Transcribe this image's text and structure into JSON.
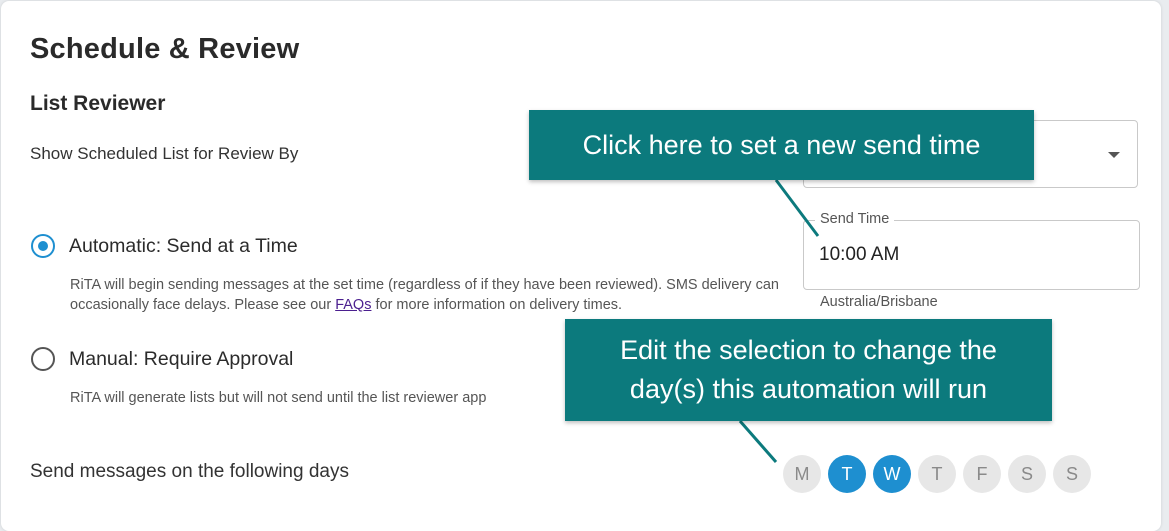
{
  "page": {
    "title": "Schedule & Review",
    "section_title": "List Reviewer"
  },
  "review": {
    "show_by_label": "Show Scheduled List for Review By",
    "select_value": ""
  },
  "send_time": {
    "label": "Send Time",
    "value": "10:00 AM",
    "timezone": "Australia/Brisbane"
  },
  "options": [
    {
      "label": "Automatic: Send at a Time",
      "checked": true,
      "helper_before": "RiTA will begin sending messages at the set time (regardless of if they have been reviewed). SMS delivery can occasionally face delays. Please see our ",
      "helper_link": "FAQs",
      "helper_after": " for more information on delivery times."
    },
    {
      "label": "Manual: Require Approval",
      "checked": false,
      "helper": "RiTA will generate lists but will not send until the list reviewer app"
    }
  ],
  "days": {
    "label": "Send messages on the following days",
    "items": [
      {
        "letter": "M",
        "selected": false
      },
      {
        "letter": "T",
        "selected": true
      },
      {
        "letter": "W",
        "selected": true
      },
      {
        "letter": "T",
        "selected": false
      },
      {
        "letter": "F",
        "selected": false
      },
      {
        "letter": "S",
        "selected": false
      },
      {
        "letter": "S",
        "selected": false
      }
    ]
  },
  "callouts": {
    "send_time": "Click here to set a new send time",
    "days_line1": "Edit the selection to change the",
    "days_line2": "day(s) this automation will run"
  },
  "colors": {
    "accent": "#1e8fd0",
    "callout_bg": "#0c7a7d",
    "day_inactive_bg": "#e7e7e7"
  }
}
